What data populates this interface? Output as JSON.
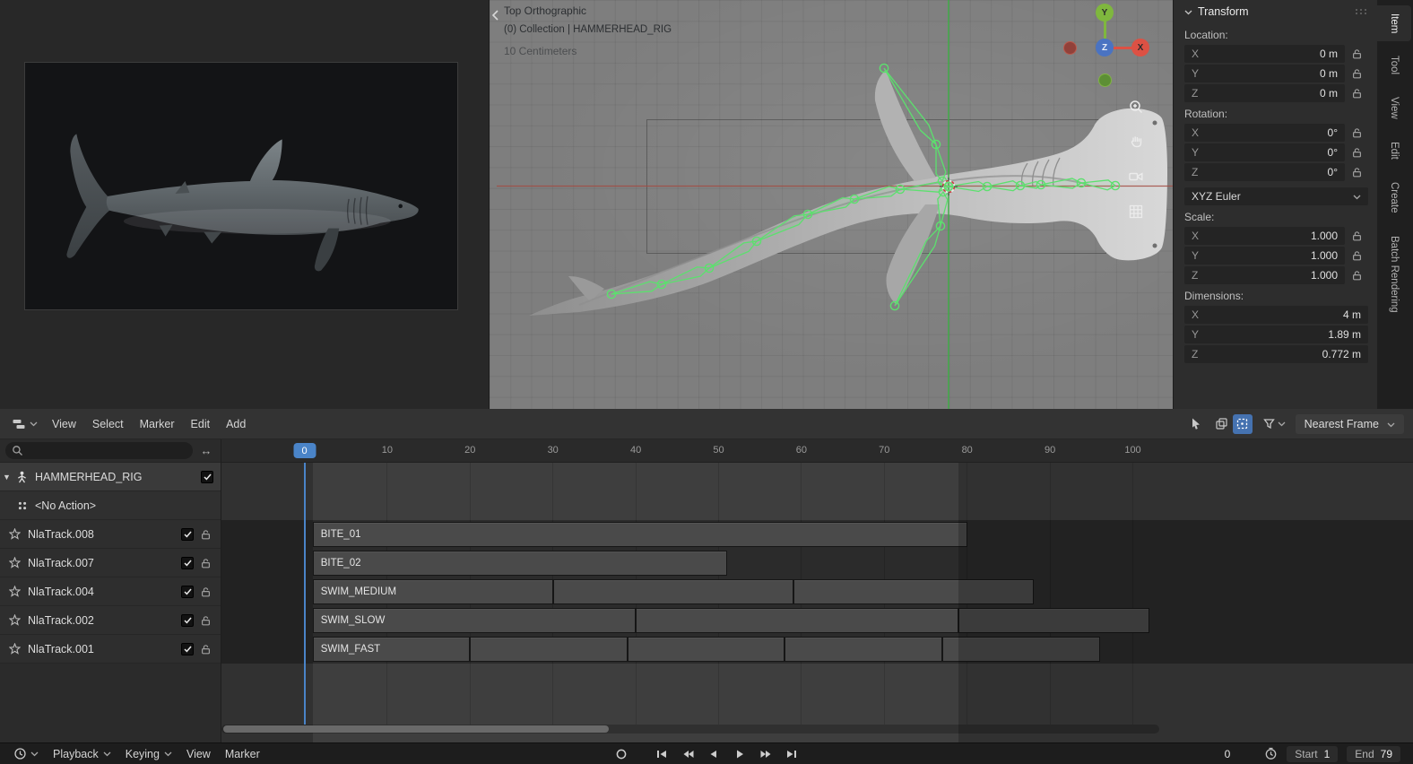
{
  "colors": {
    "accent": "#4572b0",
    "rig_green": "#5ce06e",
    "playhead": "#4a84c8"
  },
  "icons": {
    "search-icon": "magnifier",
    "expand-width-icon": "↔",
    "disclosure-triangle-icon": "▼",
    "armature-object-icon": "stick-figure",
    "action-icon": "dots",
    "solo-star-icon": "star-outline",
    "checkbox-check-icon": "✓",
    "lock-open-icon": "padlock-open",
    "filter-funnel-icon": "funnel",
    "cursor-select-icon": "arrow-cursor",
    "zoom-icon": "magnifier-plus",
    "pan-hand-icon": "hand",
    "camera-icon": "movie-camera",
    "grid-icon": "grid",
    "clock-icon": "clock",
    "record-circle-icon": "circle-outline",
    "chevron-down-icon": "⌄",
    "grip-icon": "dots-grid"
  },
  "viewport": {
    "view_label": "Top Orthographic",
    "context_label": "(0) Collection | HAMMERHEAD_RIG",
    "scale_label": "10 Centimeters",
    "gizmo": {
      "x": "X",
      "y": "Y",
      "z": "Z"
    }
  },
  "transform_panel": {
    "title": "Transform",
    "location": {
      "label": "Location:",
      "fields": [
        {
          "axis": "X",
          "value": "0 m"
        },
        {
          "axis": "Y",
          "value": "0 m"
        },
        {
          "axis": "Z",
          "value": "0 m"
        }
      ]
    },
    "rotation": {
      "label": "Rotation:",
      "fields": [
        {
          "axis": "X",
          "value": "0°"
        },
        {
          "axis": "Y",
          "value": "0°"
        },
        {
          "axis": "Z",
          "value": "0°"
        }
      ]
    },
    "rotation_mode": "XYZ Euler",
    "scale": {
      "label": "Scale:",
      "fields": [
        {
          "axis": "X",
          "value": "1.000"
        },
        {
          "axis": "Y",
          "value": "1.000"
        },
        {
          "axis": "Z",
          "value": "1.000"
        }
      ]
    },
    "dimensions": {
      "label": "Dimensions:",
      "fields": [
        {
          "axis": "X",
          "value": "4 m"
        },
        {
          "axis": "Y",
          "value": "1.89 m"
        },
        {
          "axis": "Z",
          "value": "0.772 m"
        }
      ]
    },
    "tabs": [
      {
        "label": "Item",
        "active": true
      },
      {
        "label": "Tool",
        "active": false
      },
      {
        "label": "View",
        "active": false
      },
      {
        "label": "Edit",
        "active": false
      },
      {
        "label": "Create",
        "active": false
      },
      {
        "label": "Batch Rendering",
        "active": false
      }
    ]
  },
  "nla": {
    "menus": [
      "View",
      "Select",
      "Marker",
      "Edit",
      "Add"
    ],
    "snap_mode": "Nearest Frame",
    "channels": [
      {
        "name": "HAMMERHEAD_RIG",
        "kind": "object",
        "checked": true
      },
      {
        "name": "<No Action>",
        "kind": "action"
      },
      {
        "name": "NlaTrack.008",
        "kind": "track",
        "checked": true,
        "locked": false
      },
      {
        "name": "NlaTrack.007",
        "kind": "track",
        "checked": true,
        "locked": false
      },
      {
        "name": "NlaTrack.004",
        "kind": "track",
        "checked": true,
        "locked": false
      },
      {
        "name": "NlaTrack.002",
        "kind": "track",
        "checked": true,
        "locked": false
      },
      {
        "name": "NlaTrack.001",
        "kind": "track",
        "checked": true,
        "locked": false
      }
    ],
    "ruler_ticks": [
      0,
      10,
      20,
      30,
      40,
      50,
      60,
      70,
      80,
      90,
      100
    ],
    "current_frame": 0,
    "frame_range": {
      "start": 1,
      "end": 79
    },
    "strips": [
      {
        "row": 2,
        "name": "BITE_01",
        "segments": [
          [
            1,
            80
          ]
        ]
      },
      {
        "row": 3,
        "name": "BITE_02",
        "segments": [
          [
            1,
            51
          ]
        ]
      },
      {
        "row": 4,
        "name": "SWIM_MEDIUM",
        "segments": [
          [
            1,
            30
          ],
          [
            30,
            59
          ],
          [
            59,
            88
          ]
        ]
      },
      {
        "row": 5,
        "name": "SWIM_SLOW",
        "segments": [
          [
            1,
            40
          ],
          [
            40,
            79
          ],
          [
            79,
            102
          ]
        ]
      },
      {
        "row": 6,
        "name": "SWIM_FAST",
        "segments": [
          [
            1,
            20
          ],
          [
            20,
            39
          ],
          [
            39,
            58
          ],
          [
            58,
            77
          ],
          [
            77,
            96
          ]
        ]
      }
    ]
  },
  "statusbar": {
    "menus": [
      {
        "label": "Playback",
        "chevron": true
      },
      {
        "label": "Keying",
        "chevron": true
      },
      {
        "label": "View",
        "chevron": false
      },
      {
        "label": "Marker",
        "chevron": false
      }
    ],
    "current_frame": "0",
    "start": {
      "label": "Start",
      "value": "1"
    },
    "end": {
      "label": "End",
      "value": "79"
    }
  }
}
